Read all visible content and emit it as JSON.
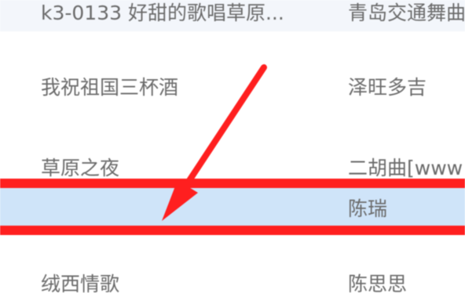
{
  "song_list": {
    "rows": [
      {
        "title": "k3-0133 好甜的歌唱草原...",
        "artist": "青岛交通舞曲"
      },
      {
        "title": "我祝祖国三杯酒",
        "artist": "泽旺多吉"
      },
      {
        "title": "草原之夜",
        "artist": "二胡曲[www"
      },
      {
        "title": "",
        "artist": "陈瑞"
      },
      {
        "title": "绒西情歌",
        "artist": "陈思思"
      }
    ]
  },
  "annotation": {
    "arrow_color": "#ff1f1f",
    "highlight_color": "#ff1f1f",
    "selected_row_color": "#cfe4f9"
  }
}
